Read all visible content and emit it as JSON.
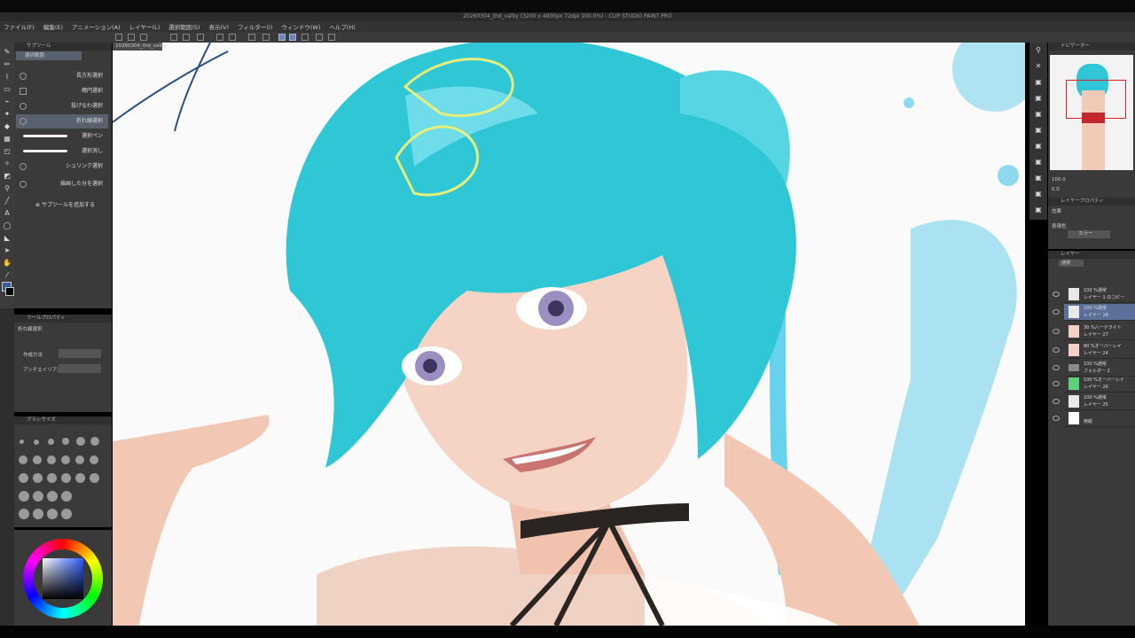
{
  "window": {
    "title": "20260304_thd_valby (3200 x 4800px 72dpi 100.0%) - CLIP STUDIO PAINT PRO"
  },
  "menu": [
    "ファイル(F)",
    "編集(E)",
    "アニメーション(A)",
    "レイヤー(L)",
    "選択範囲(S)",
    "表示(V)",
    "フィルター(I)",
    "ウィンドウ(W)",
    "ヘルプ(H)"
  ],
  "canvas_tab": "20260304_thd_valby",
  "subtool": {
    "header": "サブツール",
    "tab": "選択範囲",
    "items": [
      "長方形選択",
      "楕円選択",
      "投げなわ選択",
      "折れ線選択",
      "選択ペン",
      "選択消し",
      "シュリンク選択",
      "描画した分を選択"
    ],
    "add_label": "サブツールを追加する"
  },
  "toolprop": {
    "header": "ツールプロパティ",
    "subheader": "折れ線選択",
    "mode_label": "作成方法",
    "aa_label": "アンチエイリアス"
  },
  "brushsize": {
    "header": "ブラシサイズ"
  },
  "navigator": {
    "header": "ナビゲーター",
    "zoom": "100.0",
    "angle": "0.0"
  },
  "layerprop": {
    "header": "レイヤープロパティ",
    "effect_label": "効果",
    "color_label": "表現色",
    "color_value": "カラー"
  },
  "layers": {
    "header": "レイヤー",
    "blend": "通常",
    "rows": [
      {
        "mode": "100 %通常",
        "name": "レイヤー 1 のコピー"
      },
      {
        "mode": "100 %通常",
        "name": "レイヤー 28"
      },
      {
        "mode": "30 %ハードライト",
        "name": "レイヤー 27"
      },
      {
        "mode": "80 %オーバーレイ",
        "name": "レイヤー 24"
      },
      {
        "mode": "100 %通常",
        "name": "フォルダー 2"
      },
      {
        "mode": "100 %オーバーレイ",
        "name": "レイヤー 26"
      },
      {
        "mode": "100 %通常",
        "name": "レイヤー 25"
      },
      {
        "mode": "",
        "name": "用紙"
      }
    ]
  },
  "colors": {
    "accent": "#6f86b5",
    "hair": "#2fc6d6",
    "skin": "#f2cbb8",
    "main_color": "#3b5a8f"
  }
}
